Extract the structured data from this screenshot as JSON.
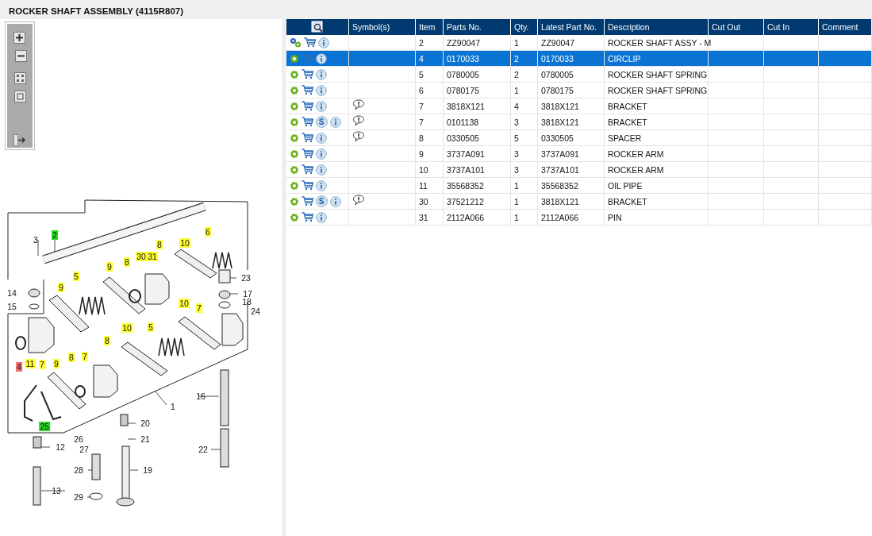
{
  "title": "ROCKER SHAFT ASSEMBLY (4115R807)",
  "diagram": {
    "callouts": [
      {
        "label": "2",
        "color": "#22dd22"
      },
      {
        "label": "3"
      },
      {
        "label": "8",
        "color": "#ffff33"
      },
      {
        "label": "10",
        "color": "#ffff33"
      },
      {
        "label": "6",
        "color": "#ffff33"
      },
      {
        "label": "30",
        "color": "#ffff33"
      },
      {
        "label": "31",
        "color": "#ffff33"
      },
      {
        "label": "8",
        "color": "#ffff33"
      },
      {
        "label": "9",
        "color": "#ffff33"
      },
      {
        "label": "5",
        "color": "#ffff33"
      },
      {
        "label": "9",
        "color": "#ffff33"
      },
      {
        "label": "23"
      },
      {
        "label": "14"
      },
      {
        "label": "15"
      },
      {
        "label": "17"
      },
      {
        "label": "18"
      },
      {
        "label": "24"
      },
      {
        "label": "10",
        "color": "#ffff33"
      },
      {
        "label": "7",
        "color": "#ffff33"
      },
      {
        "label": "10",
        "color": "#ffff33"
      },
      {
        "label": "5",
        "color": "#ffff33"
      },
      {
        "label": "8",
        "color": "#ffff33"
      },
      {
        "label": "4",
        "color": "#f07070"
      },
      {
        "label": "11",
        "color": "#ffff33"
      },
      {
        "label": "7",
        "color": "#ffff33"
      },
      {
        "label": "9",
        "color": "#ffff33"
      },
      {
        "label": "8",
        "color": "#ffff33"
      },
      {
        "label": "7",
        "color": "#ffff33"
      },
      {
        "label": "1"
      },
      {
        "label": "16"
      },
      {
        "label": "20"
      },
      {
        "label": "21"
      },
      {
        "label": "25",
        "color": "#22dd22"
      },
      {
        "label": "12"
      },
      {
        "label": "26"
      },
      {
        "label": "27"
      },
      {
        "label": "28"
      },
      {
        "label": "19"
      },
      {
        "label": "22"
      },
      {
        "label": "13"
      },
      {
        "label": "29"
      }
    ]
  },
  "table": {
    "columns": [
      "Symbol(s)",
      "Item",
      "Parts No.",
      "Qty.",
      "Latest Part No.",
      "Description",
      "Cut Out",
      "Cut In",
      "Comment"
    ],
    "rows": [
      {
        "kind": "assembly",
        "selected": false,
        "s_badge": null,
        "note": false,
        "item": "2",
        "parts_no": "ZZ90047",
        "qty": "1",
        "latest": "ZZ90047",
        "description": "ROCKER SHAFT ASSY - M"
      },
      {
        "kind": "part",
        "selected": true,
        "s_badge": null,
        "note": false,
        "item": "4",
        "parts_no": "0170033",
        "qty": "2",
        "latest": "0170033",
        "description": "CIRCLIP"
      },
      {
        "kind": "part",
        "selected": false,
        "s_badge": null,
        "note": false,
        "item": "5",
        "parts_no": "0780005",
        "qty": "2",
        "latest": "0780005",
        "description": "ROCKER SHAFT SPRING"
      },
      {
        "kind": "part",
        "selected": false,
        "s_badge": null,
        "note": false,
        "item": "6",
        "parts_no": "0780175",
        "qty": "1",
        "latest": "0780175",
        "description": "ROCKER SHAFT SPRING"
      },
      {
        "kind": "part",
        "selected": false,
        "s_badge": null,
        "note": true,
        "item": "7",
        "parts_no": "3818X121",
        "qty": "4",
        "latest": "3818X121",
        "description": "BRACKET"
      },
      {
        "kind": "part",
        "selected": false,
        "s_badge": "S",
        "note": true,
        "item": "7",
        "parts_no": "0101138",
        "qty": "3",
        "latest": "3818X121",
        "description": "BRACKET"
      },
      {
        "kind": "part",
        "selected": false,
        "s_badge": null,
        "note": true,
        "item": "8",
        "parts_no": "0330505",
        "qty": "5",
        "latest": "0330505",
        "description": "SPACER"
      },
      {
        "kind": "part",
        "selected": false,
        "s_badge": null,
        "note": false,
        "item": "9",
        "parts_no": "3737A091",
        "qty": "3",
        "latest": "3737A091",
        "description": "ROCKER ARM"
      },
      {
        "kind": "part",
        "selected": false,
        "s_badge": null,
        "note": false,
        "item": "10",
        "parts_no": "3737A101",
        "qty": "3",
        "latest": "3737A101",
        "description": "ROCKER ARM"
      },
      {
        "kind": "part",
        "selected": false,
        "s_badge": null,
        "note": false,
        "item": "11",
        "parts_no": "35568352",
        "qty": "1",
        "latest": "35568352",
        "description": "OIL PIPE"
      },
      {
        "kind": "part",
        "selected": false,
        "s_badge": "S",
        "note": true,
        "item": "30",
        "parts_no": "37521212",
        "qty": "1",
        "latest": "3818X121",
        "description": "BRACKET"
      },
      {
        "kind": "part",
        "selected": false,
        "s_badge": null,
        "note": false,
        "item": "31",
        "parts_no": "2112A066",
        "qty": "1",
        "latest": "2112A066",
        "description": "PIN"
      }
    ]
  }
}
